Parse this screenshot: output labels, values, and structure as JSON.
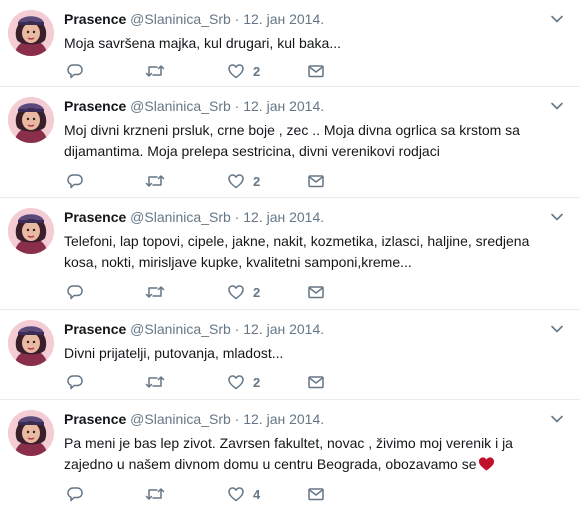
{
  "tweets": [
    {
      "name": "Prasence",
      "handle": "@Slaninica_Srb",
      "separator": "·",
      "time": "12. јан 2014.",
      "text": "Moja savršena majka, kul drugari, kul baka...",
      "likes": "2",
      "heart_emoji": false
    },
    {
      "name": "Prasence",
      "handle": "@Slaninica_Srb",
      "separator": "·",
      "time": "12. јан 2014.",
      "text": "Moj divni krzneni prsluk, crne boje , zec .. Moja divna ogrlica sa krstom sa dijamantima. Moja prelepa sestricina, divni verenikovi rodjaci",
      "likes": "2",
      "heart_emoji": false
    },
    {
      "name": "Prasence",
      "handle": "@Slaninica_Srb",
      "separator": "·",
      "time": "12. јан 2014.",
      "text": "Telefoni, lap topovi, cipele, jakne, nakit, kozmetika, izlasci, haljine, sredjena kosa, nokti, mirisljave kupke, kvalitetni samponi,kreme...",
      "likes": "2",
      "heart_emoji": false
    },
    {
      "name": "Prasence",
      "handle": "@Slaninica_Srb",
      "separator": "·",
      "time": "12. јан 2014.",
      "text": "Divni prijatelji, putovanja, mladost...",
      "likes": "2",
      "heart_emoji": false
    },
    {
      "name": "Prasence",
      "handle": "@Slaninica_Srb",
      "separator": "·",
      "time": "12. јан 2014.",
      "text": "Pa meni je bas lep zivot. Zavrsen fakultet, novac , živimo moj verenik i ja zajedno u našem divnom domu u centru Beograda, obozavamo se",
      "likes": "4",
      "heart_emoji": true
    }
  ],
  "colors": {
    "text": "#14171a",
    "muted": "#657786",
    "divider": "#e6ecf0",
    "heart_emoji": "#c0102b"
  },
  "icons": [
    "reply-icon",
    "retweet-icon",
    "like-icon",
    "direct-message-icon",
    "caret-down-icon",
    "red-heart-emoji"
  ]
}
